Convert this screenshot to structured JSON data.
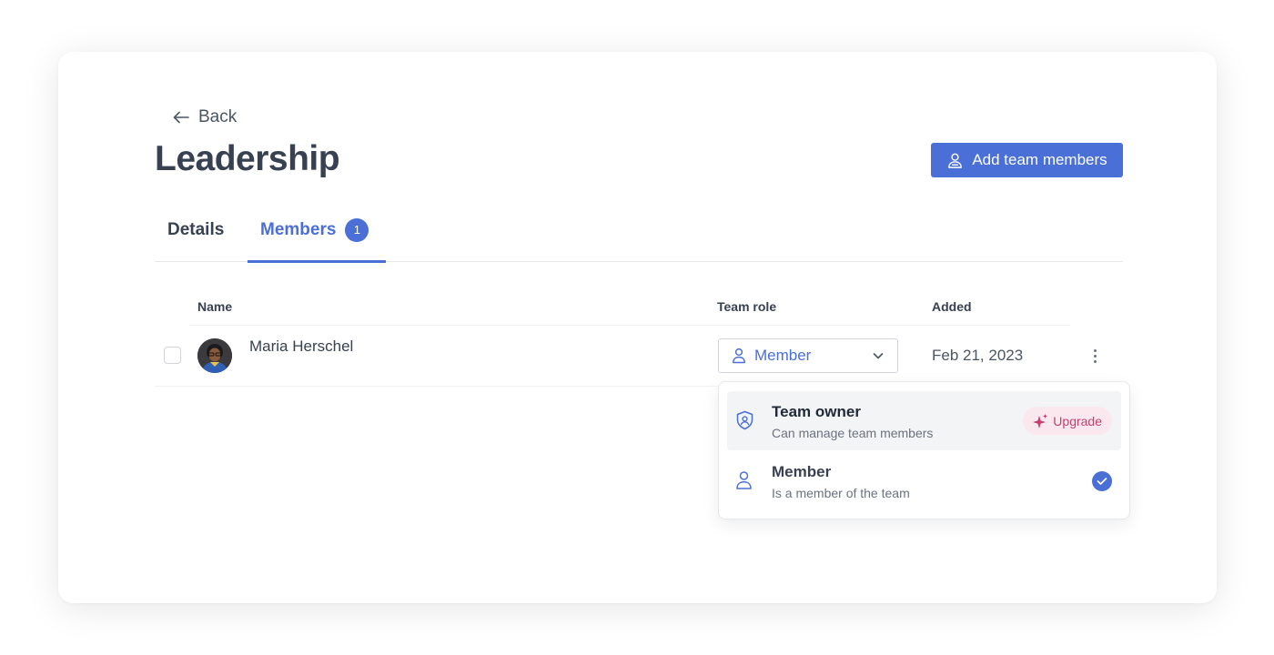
{
  "header": {
    "back_label": "Back",
    "title": "Leadership",
    "add_button_label": "Add team members"
  },
  "tabs": [
    {
      "label": "Details",
      "active": false
    },
    {
      "label": "Members",
      "active": true,
      "count": "1"
    }
  ],
  "table": {
    "columns": [
      "Name",
      "Team role",
      "Added"
    ],
    "rows": [
      {
        "name": "Maria Herschel",
        "role": "Member",
        "added": "Feb 21, 2023"
      }
    ]
  },
  "role_dropdown": {
    "options": [
      {
        "title": "Team owner",
        "description": "Can manage team members",
        "badge": "Upgrade",
        "icon": "shield-user-icon",
        "selected": false
      },
      {
        "title": "Member",
        "description": "Is a member of the team",
        "icon": "user-icon",
        "selected": true
      }
    ]
  },
  "colors": {
    "accent": "#4a6fd6",
    "upgrade_bg": "#fbe8ef",
    "upgrade_text": "#c2416c"
  }
}
